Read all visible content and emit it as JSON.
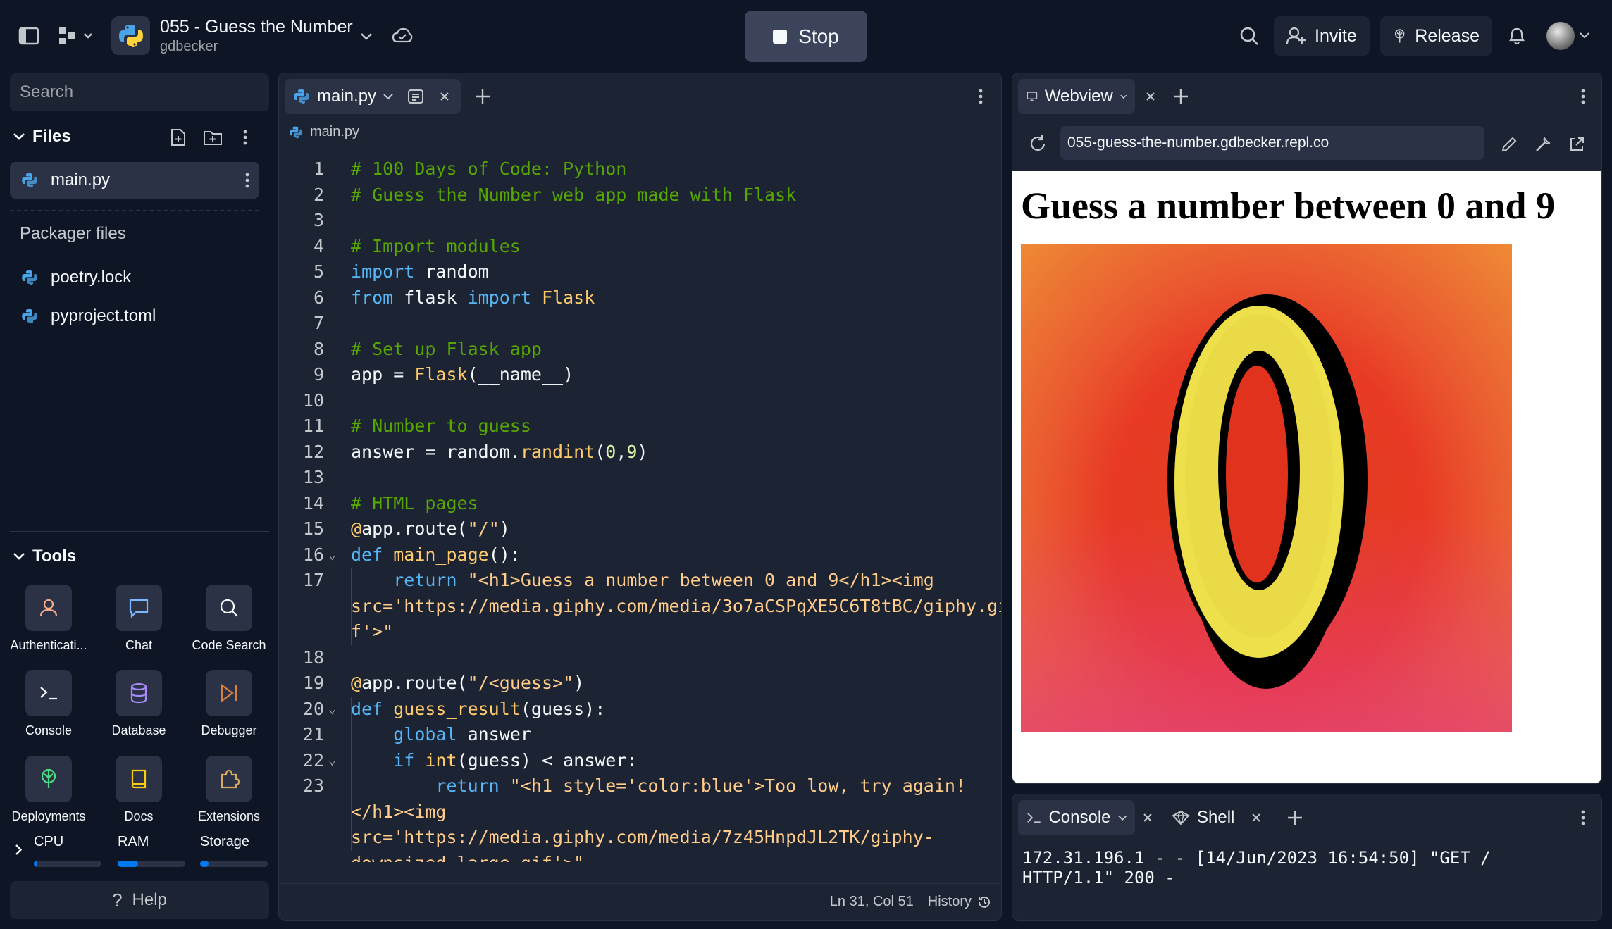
{
  "repl": {
    "title": "055 - Guess the Number",
    "owner": "gdbecker"
  },
  "topbar": {
    "stop_label": "Stop",
    "invite_label": "Invite",
    "release_label": "Release"
  },
  "sidebar": {
    "search_placeholder": "Search",
    "files_label": "Files",
    "active_file": "main.py",
    "packager_label": "Packager files",
    "packager_files": [
      "poetry.lock",
      "pyproject.toml"
    ],
    "tools_label": "Tools",
    "tools": [
      "Authenticati...",
      "Chat",
      "Code Search",
      "Console",
      "Database",
      "Debugger",
      "Deployments",
      "Docs",
      "Extensions"
    ],
    "resources": [
      {
        "label": "CPU",
        "fraction": 0.05
      },
      {
        "label": "RAM",
        "fraction": 0.3
      },
      {
        "label": "Storage",
        "fraction": 0.12
      }
    ],
    "help_label": "Help"
  },
  "editor": {
    "tab_label": "main.py",
    "breadcrumb": "main.py",
    "lines": [
      {
        "n": "1",
        "text": "# 100 Days of Code: Python"
      },
      {
        "n": "2",
        "text": "# Guess the Number web app made with Flask"
      },
      {
        "n": "3",
        "text": ""
      },
      {
        "n": "4",
        "text": "# Import modules"
      },
      {
        "n": "5",
        "text": "import random"
      },
      {
        "n": "6",
        "text": "from flask import Flask"
      },
      {
        "n": "7",
        "text": ""
      },
      {
        "n": "8",
        "text": "# Set up Flask app"
      },
      {
        "n": "9",
        "text": "app = Flask(__name__)"
      },
      {
        "n": "10",
        "text": ""
      },
      {
        "n": "11",
        "text": "# Number to guess"
      },
      {
        "n": "12",
        "text": "answer = random.randint(0,9)"
      },
      {
        "n": "13",
        "text": ""
      },
      {
        "n": "14",
        "text": "# HTML pages"
      },
      {
        "n": "15",
        "text": "@app.route(\"/\")"
      },
      {
        "n": "16",
        "text": "def main_page():"
      },
      {
        "n": "17",
        "text": "    return \"<h1>Guess a number between 0 and 9</h1><img"
      },
      {
        "n": "",
        "text": "src='https://media.giphy.com/media/3o7aCSPqXE5C6T8tBC/giphy.gi"
      },
      {
        "n": "",
        "text": "f'>\""
      },
      {
        "n": "18",
        "text": ""
      },
      {
        "n": "19",
        "text": "@app.route(\"/<guess>\")"
      },
      {
        "n": "20",
        "text": "def guess_result(guess):"
      },
      {
        "n": "21",
        "text": "    global answer"
      },
      {
        "n": "22",
        "text": "    if int(guess) < answer:"
      },
      {
        "n": "23",
        "text": "        return \"<h1 style='color:blue'>Too low, try again!"
      },
      {
        "n": "",
        "text": "</h1><img"
      },
      {
        "n": "",
        "text": "src='https://media.giphy.com/media/7z45HnpdJL2TK/giphy-"
      },
      {
        "n": "",
        "text": "downsized-large.gif'>\""
      }
    ],
    "status_position": "Ln 31, Col 51",
    "history_label": "History"
  },
  "webview": {
    "tab_label": "Webview",
    "url": "055-guess-the-number.gdbecker.repl.co",
    "heading": "Guess a number between 0 and 9",
    "gif_digit": "0"
  },
  "console": {
    "tab_label": "Console",
    "shell_label": "Shell",
    "output": "172.31.196.1 - - [14/Jun/2023 16:54:50] \"GET / HTTP/1.1\" 200 -"
  },
  "colors": {
    "background": "#0e1525",
    "panel": "#1c2333",
    "surface": "#2b3245",
    "accent": "#0079f2",
    "comment": "#58a700",
    "keyword": "#56b6f7",
    "function": "#ffcb6b",
    "string": "#ffcc8a",
    "number": "#d9f7a6"
  }
}
